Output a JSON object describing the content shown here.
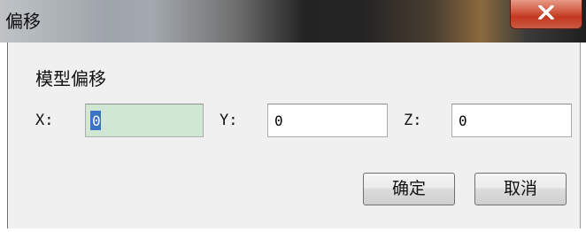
{
  "window": {
    "title": "偏移"
  },
  "group": {
    "label": "模型偏移"
  },
  "fields": {
    "x": {
      "label": "X:",
      "value": "0"
    },
    "y": {
      "label": "Y:",
      "value": "0"
    },
    "z": {
      "label": "Z:",
      "value": "0"
    }
  },
  "buttons": {
    "ok": "确定",
    "cancel": "取消"
  },
  "icons": {
    "close": "close-icon"
  },
  "colors": {
    "close_button": "#c8452c",
    "selection": "#3a73c6",
    "field_focus": "#cfe7d3"
  }
}
